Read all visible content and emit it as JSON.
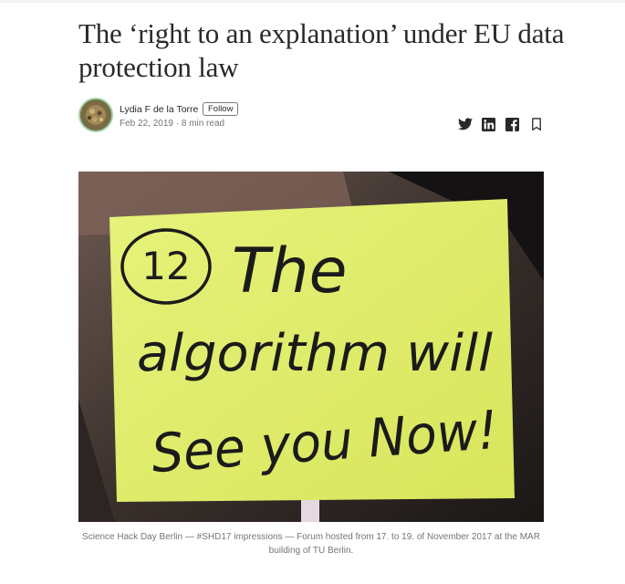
{
  "article": {
    "title": "The ‘right to an explanation’ under EU data protection law"
  },
  "author": {
    "name": "Lydia F de la Torre",
    "follow_label": "Follow",
    "date": "Feb 22, 2019",
    "separator": " · ",
    "read_time": "8 min read"
  },
  "share": {
    "icons": [
      "twitter-icon",
      "linkedin-icon",
      "facebook-icon",
      "bookmark-icon"
    ]
  },
  "hero_image": {
    "note_number": "12",
    "note_line1": "The",
    "note_line2": "algorithm will",
    "note_line3": "See you Now!",
    "caption": "Science Hack Day Berlin — #SHD17 impressions — Forum hosted from 17. to 19. of November 2017 at the MAR building of TU Berlin."
  },
  "colors": {
    "text": "#292929",
    "muted": "#757575",
    "note": "#e3f06a",
    "avatar_ring": "#9fd5a8"
  }
}
